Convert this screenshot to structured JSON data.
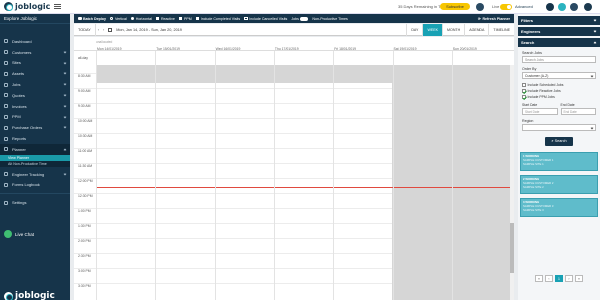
{
  "brand": {
    "name": "joblogic"
  },
  "topbar": {
    "trial_text": "35 Days Remaining in Trial",
    "subscribe_label": "Subscribe",
    "live_label": "Live",
    "advanced_label": "Advanced"
  },
  "sidebar": {
    "company": "Explore Joblogic",
    "items": [
      {
        "label": "Dashboard"
      },
      {
        "label": "Customers"
      },
      {
        "label": "Sites"
      },
      {
        "label": "Assets"
      },
      {
        "label": "Jobs"
      },
      {
        "label": "Quotes"
      },
      {
        "label": "Invoices"
      },
      {
        "label": "PPM"
      },
      {
        "label": "Purchase Orders"
      },
      {
        "label": "Reports"
      },
      {
        "label": "Planner"
      }
    ],
    "planner_sub": [
      {
        "label": "View Planner"
      },
      {
        "label": "Alt Non-Productive Time"
      }
    ],
    "lower_items": [
      {
        "label": "Engineer Tracking"
      },
      {
        "label": "Forms Logbook"
      }
    ],
    "settings_label": "Settings",
    "live_chat_label": "Live Chat"
  },
  "toolbar": {
    "batch_deploy": "Batch Deploy",
    "vertical": "Vertical",
    "horizontal": "Horizontal",
    "reactive": "Reactive",
    "ppm": "PPM",
    "include_completed": "Include Completed Visits",
    "include_cancelled": "Include Cancelled Visits",
    "jobs": "Jobs",
    "non_productive": "Non-Productive Times",
    "refresh": "Refresh Planner"
  },
  "calnav": {
    "today": "TODAY",
    "prev": "‹",
    "next": "›",
    "range": "Mon, Jan 14, 2019 - Sun, Jan 20, 2019",
    "views": [
      "DAY",
      "WEEK",
      "MONTH",
      "AGENDA",
      "TIMELINE"
    ],
    "active_view": "WEEK"
  },
  "calendar": {
    "unlabelled": "unallocated",
    "all_day": "all-day",
    "days": [
      "Mon 14/01/2019",
      "Tue 15/01/2019",
      "Wed 16/01/2019",
      "Thu 17/01/2019",
      "Fri 18/01/2019",
      "Sat 19/01/2019",
      "Sun 20/01/2019"
    ],
    "times": [
      "8:30 AM",
      "9:00 AM",
      "9:30 AM",
      "10:00 AM",
      "10:30 AM",
      "11:00 AM",
      "11:30 AM",
      "12:00 PM",
      "12:30 PM",
      "1:00 PM",
      "1:30 PM",
      "2:00 PM",
      "2:30 PM",
      "3:00 PM",
      "3:30 PM"
    ]
  },
  "filters": {
    "filters_title": "Filters",
    "engineers_title": "Engineers",
    "search_title": "Search",
    "search_jobs_label": "Search Jobs",
    "search_jobs_placeholder": "Search Jobs",
    "order_by_label": "Order By",
    "order_by_value": "Customer (A-Z)",
    "include_scheduled": "Include Scheduled Jobs",
    "include_reactive": "Include Reactive Jobs",
    "include_ppm": "Include PPM Jobs",
    "start_date_label": "Start Date",
    "start_date_placeholder": "Start Date",
    "end_date_label": "End Date",
    "end_date_placeholder": "End Date",
    "region_label": "Region",
    "search_button": "Search"
  },
  "jobs": [
    {
      "title": "1 WORKING",
      "line1": "SAMPLE CUSTOMER 1",
      "line2": "SAMPLE SITE 1"
    },
    {
      "title": "2 WORKING",
      "line1": "SAMPLE CUSTOMER 2",
      "line2": "SAMPLE SITE 2"
    },
    {
      "title": "3 WORKING",
      "line1": "SAMPLE CUSTOMER 3",
      "line2": "SAMPLE SITE 3"
    }
  ],
  "pager": {
    "first": "«",
    "prev": "‹",
    "current": "1",
    "next": "›",
    "last": "»"
  },
  "colors": {
    "navy": "#16344a",
    "teal": "#18a1b4",
    "accent_yellow": "#f7c600",
    "now_line": "#e04a3f",
    "job_card": "#5fbccb"
  }
}
